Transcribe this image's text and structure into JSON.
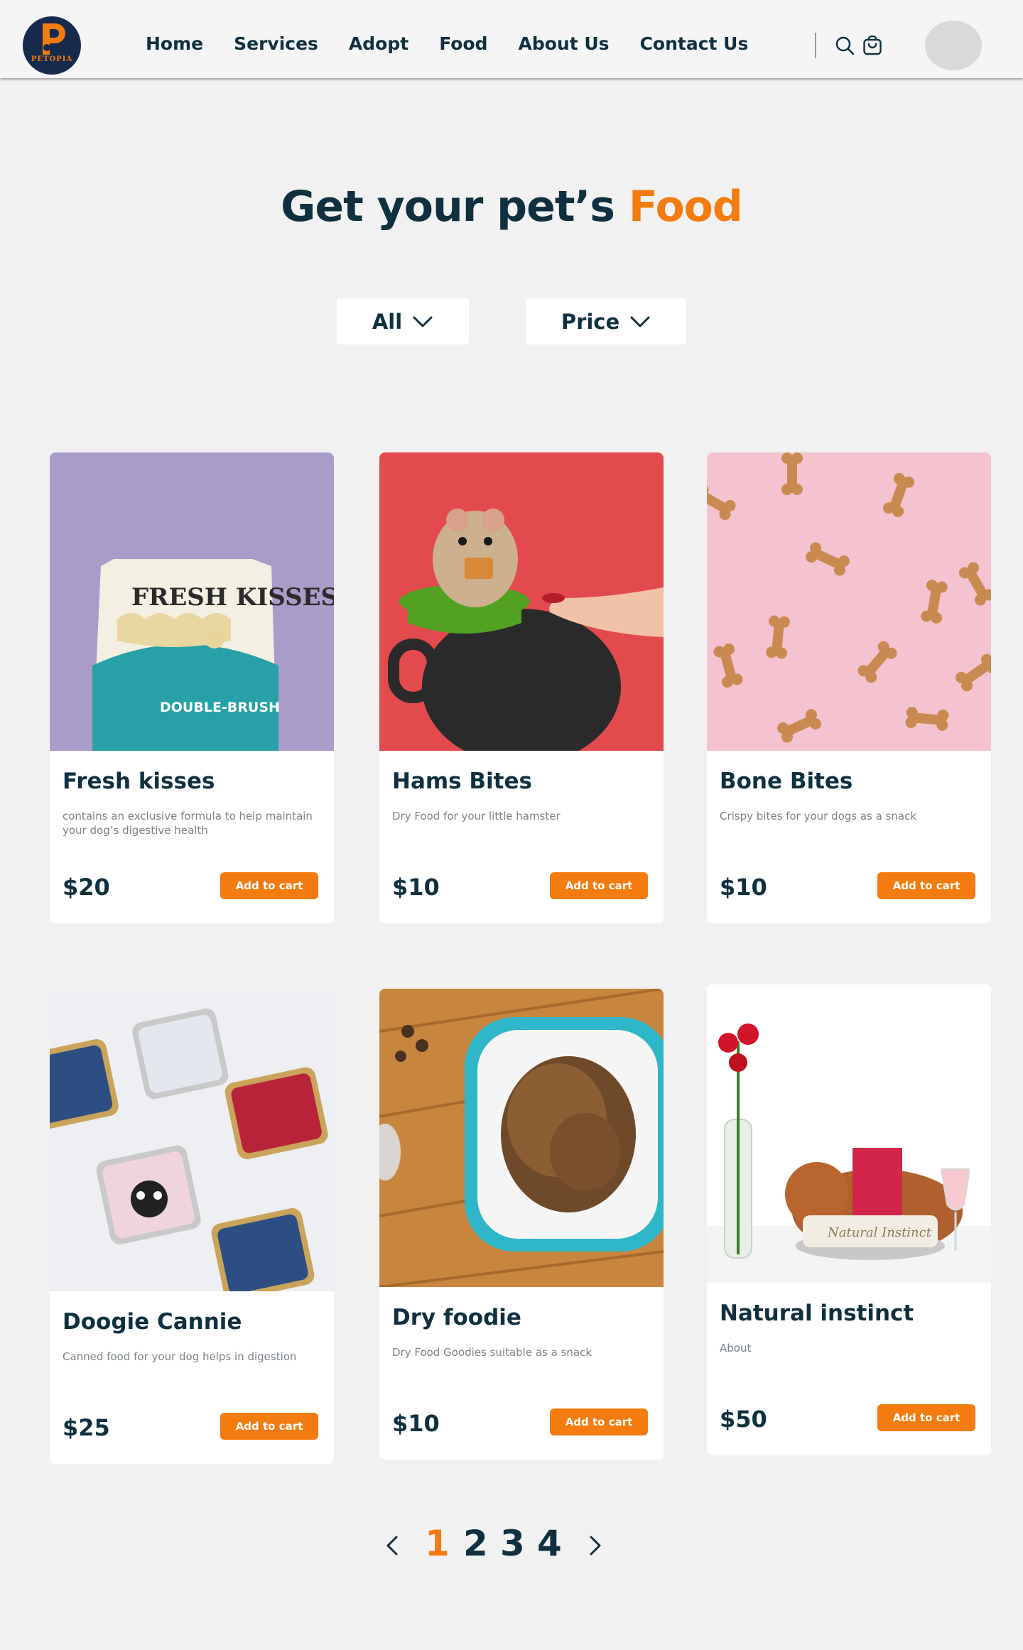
{
  "header": {
    "logo_text": "PETOPIA",
    "nav": [
      "Home",
      "Services",
      "Adopt",
      "Food",
      "About Us",
      "Contact Us"
    ],
    "icons": [
      "search-icon",
      "cart-icon"
    ]
  },
  "main": {
    "title_prefix": "Get your pet’s ",
    "title_accent": "Food",
    "accent_color": "#f47b0f",
    "filters": [
      {
        "label": "All",
        "icon": "chevron-down-icon"
      },
      {
        "label": "Price",
        "icon": "chevron-down-icon"
      }
    ]
  },
  "products": [
    {
      "name": "Fresh kisses",
      "description": "contains an exclusive formula to help maintain your dog’s digestive health",
      "price": "$20",
      "button": "Add to cart",
      "image_text": "FRESH KISSES",
      "image_subtext": "DOUBLE-BRUSH"
    },
    {
      "name": "Hams Bites",
      "description": "Dry Food for your little hamster",
      "price": "$10",
      "button": "Add to cart"
    },
    {
      "name": "Bone Bites",
      "description": "Crispy bites for your dogs as a snack",
      "price": "$10",
      "button": "Add to cart"
    },
    {
      "name": "Doogie Cannie",
      "description": "Canned food for your dog helps in digestion",
      "price": "$25",
      "button": "Add to cart"
    },
    {
      "name": "Dry foodie",
      "description": "Dry Food Goodies suitable as a snack",
      "price": "$10",
      "button": "Add to cart"
    },
    {
      "name": "Natural instinct",
      "description": "About",
      "price": "$50",
      "button": "Add to cart",
      "image_text": "Natural Instinct"
    }
  ],
  "pagination": {
    "pages": [
      "1",
      "2",
      "3",
      "4"
    ],
    "current": "1",
    "prev_icon": "chevron-left-icon",
    "next_icon": "chevron-right-icon"
  }
}
